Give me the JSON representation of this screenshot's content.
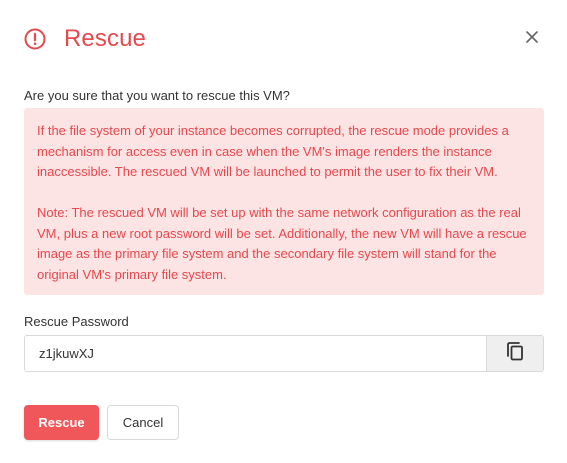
{
  "dialog": {
    "title": "Rescue",
    "question": "Are you sure that you want to rescue this VM?",
    "warning": {
      "paragraph1": "If the file system of your instance becomes corrupted, the rescue mode provides a mechanism for access even in case when the VM's image renders the instance inaccessible. The rescued VM will be launched to permit the user to fix their VM.",
      "paragraph2": "Note: The rescued VM will be set up with the same network configuration as the real VM, plus a new root password will be set. Additionally, the new VM will have a rescue image as the primary file system and the secondary file system will stand for the original VM's primary file system."
    },
    "password_field": {
      "label": "Rescue Password",
      "value": "z1jkuwXJ"
    },
    "buttons": {
      "rescue_label": "Rescue",
      "cancel_label": "Cancel"
    }
  },
  "icons": {
    "header": "alert-circle-icon",
    "close": "close-icon",
    "copy": "copy-icon"
  },
  "colors": {
    "accent": "#e5484d",
    "warning_bg": "#fde4e4",
    "primary_button": "#f0575b"
  }
}
